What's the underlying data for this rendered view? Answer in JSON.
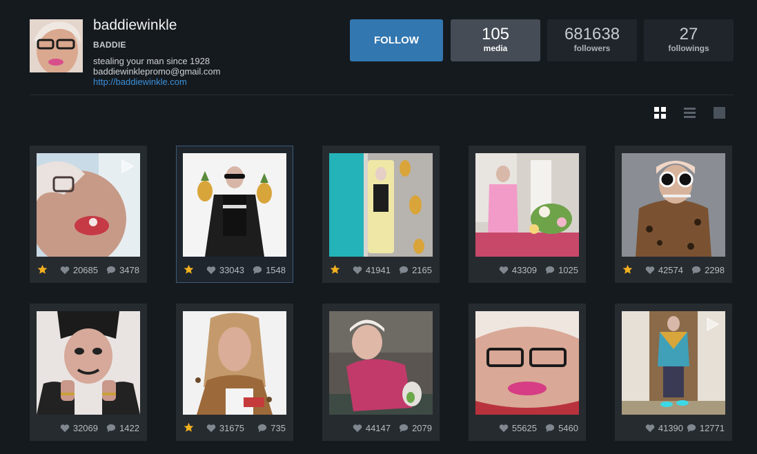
{
  "profile": {
    "username": "baddiewinkle",
    "full_name": "BADDIE",
    "bio_line1": "stealing your man since 1928",
    "bio_line2": "baddiewinklepromo@gmail.com",
    "website": "http://baddiewinkle.com"
  },
  "actions": {
    "follow_label": "FOLLOW"
  },
  "stats": [
    {
      "value": "105",
      "label": "media"
    },
    {
      "value": "681638",
      "label": "followers"
    },
    {
      "value": "27",
      "label": "followings"
    }
  ],
  "view_modes": [
    "grid-view-icon",
    "list-view-icon",
    "single-view-icon"
  ],
  "colors": {
    "accent": "#3377b0",
    "star": "#f2b01e",
    "link": "#3b8fd9"
  },
  "posts": [
    {
      "likes": "20685",
      "comments": "3478",
      "starred": true,
      "video": true
    },
    {
      "likes": "33043",
      "comments": "1548",
      "starred": true,
      "video": false
    },
    {
      "likes": "41941",
      "comments": "2165",
      "starred": true,
      "video": false
    },
    {
      "likes": "43309",
      "comments": "1025",
      "starred": false,
      "video": false
    },
    {
      "likes": "42574",
      "comments": "2298",
      "starred": true,
      "video": false
    },
    {
      "likes": "32069",
      "comments": "1422",
      "starred": false,
      "video": false
    },
    {
      "likes": "31675",
      "comments": "735",
      "starred": true,
      "video": false
    },
    {
      "likes": "44147",
      "comments": "2079",
      "starred": false,
      "video": false
    },
    {
      "likes": "55625",
      "comments": "5460",
      "starred": false,
      "video": false
    },
    {
      "likes": "41390",
      "comments": "12771",
      "starred": false,
      "video": true
    }
  ]
}
